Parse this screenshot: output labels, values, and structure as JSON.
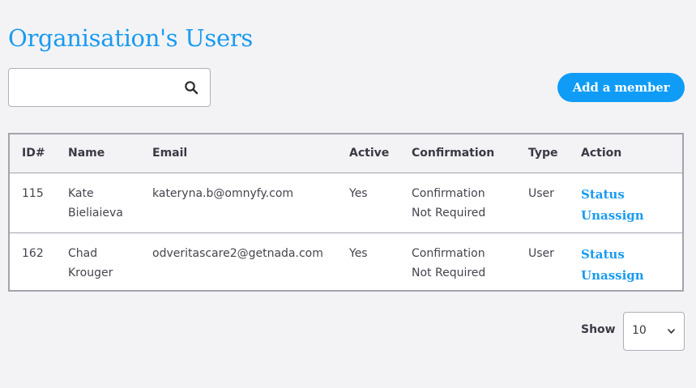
{
  "page": {
    "title": "Organisation's Users"
  },
  "search": {
    "value": "",
    "placeholder": ""
  },
  "toolbar": {
    "add_member_label": "Add a member"
  },
  "table": {
    "columns": [
      "ID#",
      "Name",
      "Email",
      "Active",
      "Confirmation",
      "Type",
      "Action"
    ],
    "rows": [
      {
        "id": "115",
        "name_line1": "Kate",
        "name_line2": "Bieliaieva",
        "email": "kateryna.b@omnyfy.com",
        "active": "Yes",
        "confirmation_line1": "Confirmation",
        "confirmation_line2": "Not Required",
        "type": "User",
        "action_status": "Status",
        "action_unassign": "Unassign"
      },
      {
        "id": "162",
        "name_line1": "Chad",
        "name_line2": "Krouger",
        "email": "odveritascare2@getnada.com",
        "active": "Yes",
        "confirmation_line1": "Confirmation",
        "confirmation_line2": "Not Required",
        "type": "User",
        "action_status": "Status",
        "action_unassign": "Unassign"
      }
    ]
  },
  "pagination": {
    "show_label": "Show",
    "page_size": "10"
  },
  "colors": {
    "accent": "#1a9bf0",
    "button": "#0e9cf7",
    "background": "#f3f3f6",
    "border": "#a3a3ad"
  },
  "icons": {
    "search": "search-icon",
    "select": "chevron-down-icon"
  }
}
